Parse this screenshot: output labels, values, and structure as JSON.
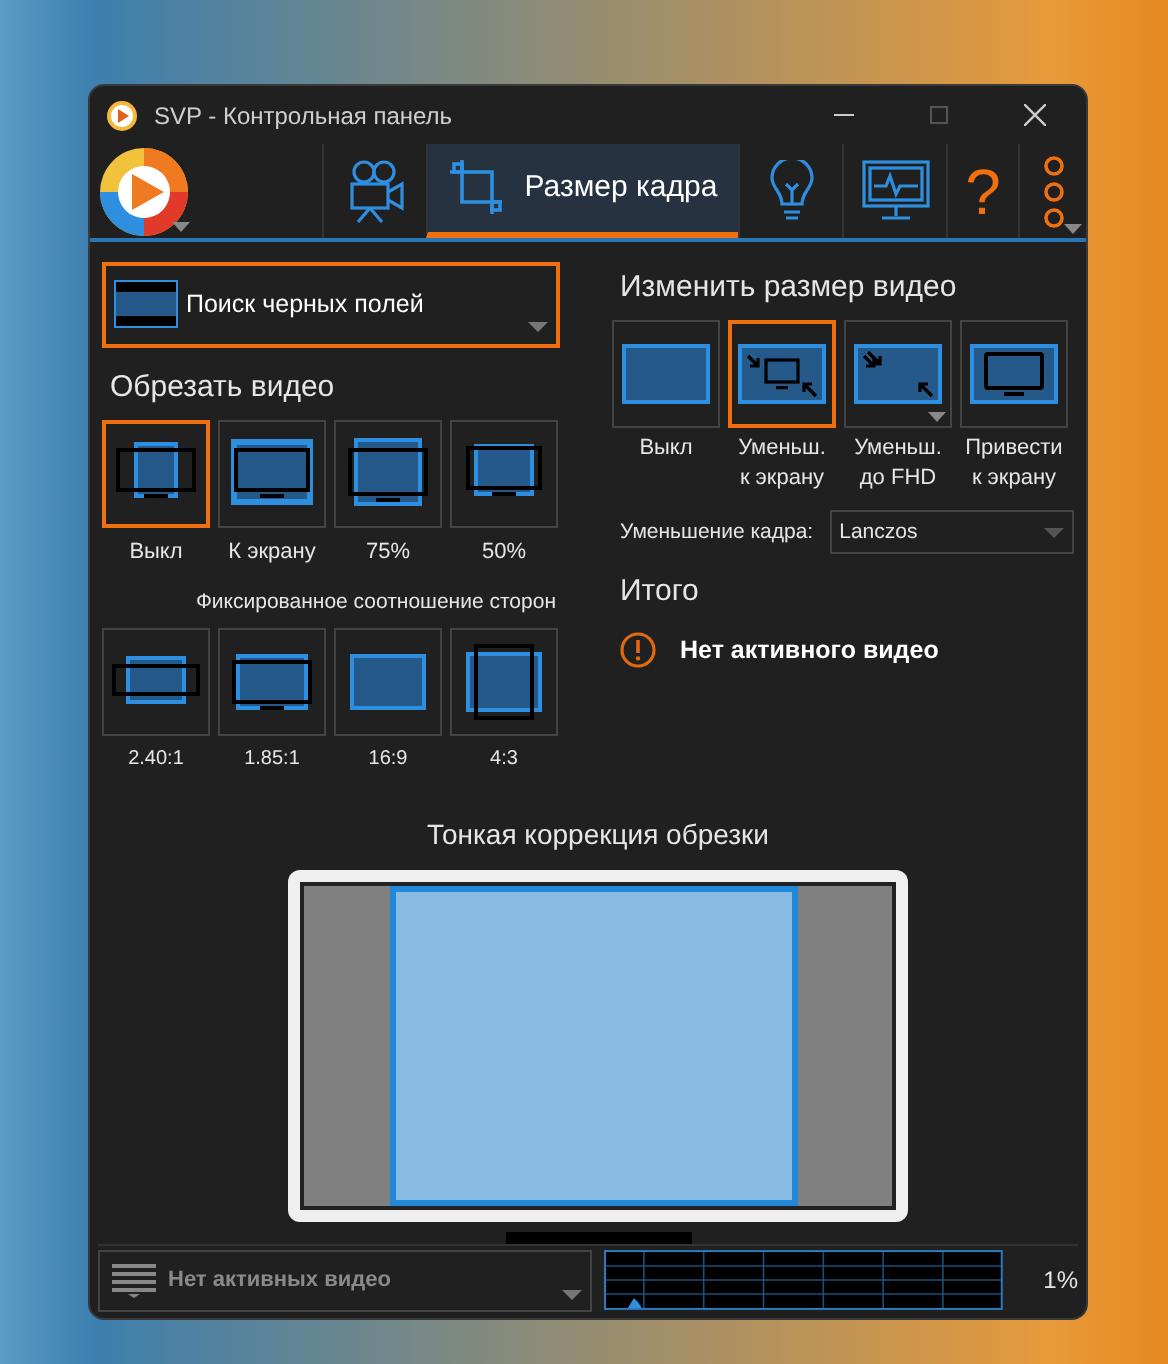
{
  "window": {
    "title": "SVP - Контрольная панель"
  },
  "toolbar": {
    "tabs": [
      {
        "kind": "camera",
        "selected": false
      },
      {
        "kind": "crop",
        "label": "Размер кадра",
        "selected": true
      },
      {
        "kind": "bulb",
        "selected": false
      },
      {
        "kind": "monitor",
        "selected": false
      },
      {
        "kind": "help",
        "label": "?",
        "selected": false
      },
      {
        "kind": "more",
        "selected": false
      }
    ]
  },
  "black_bars": {
    "label": "Поиск черных полей",
    "highlighted": true
  },
  "crop": {
    "title": "Обрезать видео",
    "options": [
      {
        "kind": "off",
        "label": "Выкл",
        "selected": true
      },
      {
        "kind": "fit",
        "label": "К экрану",
        "selected": false
      },
      {
        "kind": "p75",
        "label": "75%",
        "selected": false
      },
      {
        "kind": "p50",
        "label": "50%",
        "selected": false
      }
    ],
    "aspect_title": "Фиксированное соотношение сторон",
    "aspect_options": [
      {
        "kind": "a240",
        "label": "2.40:1",
        "selected": false
      },
      {
        "kind": "a185",
        "label": "1.85:1",
        "selected": false
      },
      {
        "kind": "a169",
        "label": "16:9",
        "selected": false
      },
      {
        "kind": "a43",
        "label": "4:3",
        "selected": false
      }
    ]
  },
  "resize": {
    "title": "Изменить размер видео",
    "options": [
      {
        "kind": "off",
        "label": "Выкл",
        "selected": false
      },
      {
        "kind": "shrink",
        "label": "Уменьш.\nк экрану",
        "selected": true
      },
      {
        "kind": "fhd",
        "label": "Уменьш.\nдо FHD",
        "selected": false
      },
      {
        "kind": "fit",
        "label": "Привести\nк экрану",
        "selected": false
      }
    ],
    "downscale_label": "Уменьшение кадра:",
    "downscale_value": "Lanczos"
  },
  "summary": {
    "title": "Итого",
    "message": "Нет активного видео"
  },
  "fine_crop": {
    "title": "Тонкая коррекция обрезки"
  },
  "status_bar": {
    "videos": "Нет активных видео",
    "cpu": "1%"
  }
}
